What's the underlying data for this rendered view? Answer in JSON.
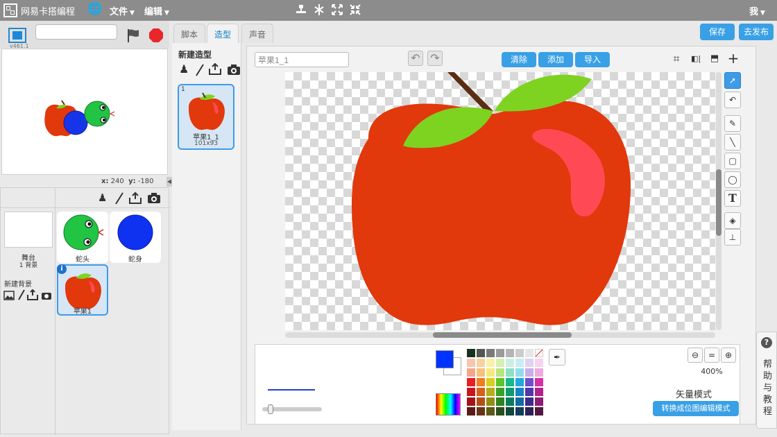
{
  "topbar": {
    "app_title": "网易卡搭编程",
    "menu_file": "文件",
    "menu_edit": "编辑",
    "user_menu": "我"
  },
  "stage": {
    "version": "v461.1",
    "project_name": "",
    "coords": {
      "x_label": "x:",
      "x_value": "240",
      "y_label": "y:",
      "y_value": "-180"
    }
  },
  "sprites": {
    "stage_thumb": {
      "name": "舞台",
      "sub": "1 背景"
    },
    "new_backdrop_label": "新建背景",
    "items": [
      {
        "name": "蛇头"
      },
      {
        "name": "蛇身"
      },
      {
        "name": "苹果1"
      }
    ]
  },
  "tabs": {
    "script": "脚本",
    "costume": "造型",
    "sound": "声音"
  },
  "actions": {
    "save": "保存",
    "publish": "去发布"
  },
  "costumes": {
    "new_costume_label": "新建造型",
    "items": [
      {
        "index": "1",
        "name": "苹果1_1",
        "size": "101x93"
      }
    ]
  },
  "editor": {
    "costume_name": "苹果1_1",
    "clear": "清除",
    "add": "添加",
    "import": "导入",
    "zoom": "400%",
    "mode_label": "矢量模式",
    "convert_button": "转换成位图编辑模式",
    "primary_color": "#0033ff",
    "palette": [
      [
        "#17311f",
        "#555555",
        "#7a7a7a",
        "#9a9a9a",
        "#b5b5b5",
        "#cccccc",
        "#e6e6e6",
        "#ffffff"
      ],
      [
        "#f6c6b0",
        "#f7d2a0",
        "#f9f1a8",
        "#d9efb2",
        "#cceee0",
        "#c9ecf3",
        "#e0d2f0",
        "#f7d3ee"
      ],
      [
        "#f4a58c",
        "#f8c07a",
        "#f4ea7c",
        "#b9e47f",
        "#8ee0c4",
        "#91dcec",
        "#c8aee8",
        "#f0a9de"
      ],
      [
        "#e81e25",
        "#f07d1e",
        "#d9cf1d",
        "#5fc42b",
        "#16b98d",
        "#23a8dd",
        "#6d4fcf",
        "#d531a6"
      ],
      [
        "#c8171c",
        "#d6611a",
        "#b7ae1a",
        "#3ba126",
        "#0e9b72",
        "#1784c3",
        "#4f36aa",
        "#b1228d"
      ],
      [
        "#a31317",
        "#b44e16",
        "#958e14",
        "#2d831d",
        "#0b7d5d",
        "#136aa2",
        "#3d2a8a",
        "#8f1b72"
      ],
      [
        "#5a1b18",
        "#6b3316",
        "#5e5a14",
        "#2a4f1c",
        "#0f4a3a",
        "#143d5c",
        "#2d2257",
        "#54173f"
      ]
    ]
  },
  "help": {
    "label": "帮助与教程"
  }
}
